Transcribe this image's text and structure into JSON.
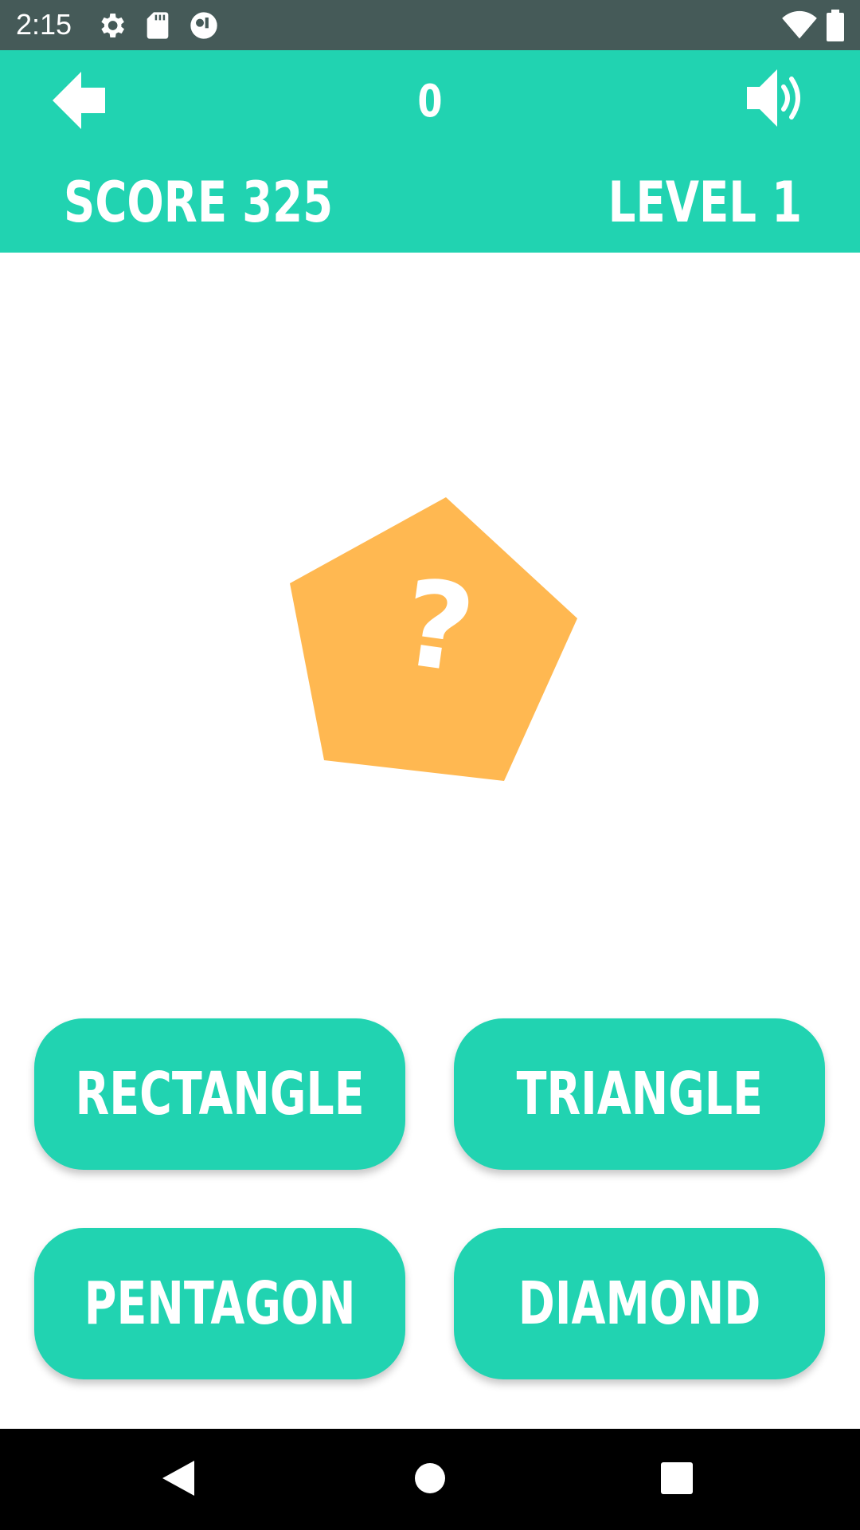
{
  "status_bar": {
    "time": "2:15",
    "icons": [
      "gear-icon",
      "sd-card-icon",
      "app-notification-icon",
      "wifi-icon",
      "battery-icon"
    ]
  },
  "header": {
    "back_icon": "arrow-left-icon",
    "counter": "0",
    "sound_icon": "speaker-icon",
    "score_label": "SCORE 325",
    "level_label": "LEVEL 1"
  },
  "question": {
    "shape": "pentagon",
    "symbol": "?"
  },
  "answers": [
    {
      "label": "RECTANGLE"
    },
    {
      "label": "TRIANGLE"
    },
    {
      "label": "PENTAGON"
    },
    {
      "label": "DIAMOND"
    }
  ],
  "nav_bar": {
    "icons": [
      "back-triangle-icon",
      "home-circle-icon",
      "recents-square-icon"
    ]
  },
  "colors": {
    "accent": "#21d3b1",
    "shape_fill": "#ffb851",
    "status_bar": "#455a58",
    "nav_bar": "#000000",
    "text_light": "#ffffff"
  }
}
